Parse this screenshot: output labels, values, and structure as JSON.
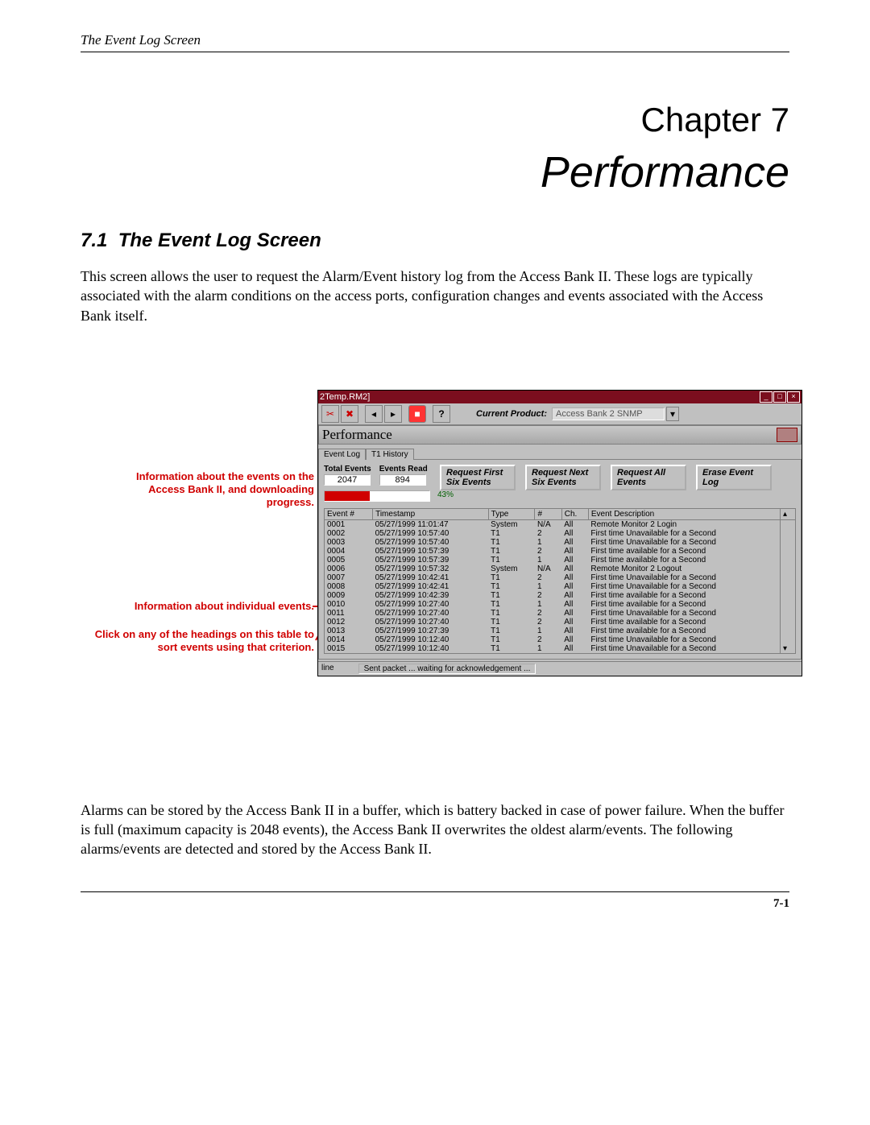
{
  "running_head": "The Event Log Screen",
  "chapter_label": "Chapter 7",
  "chapter_title": "Performance",
  "section_number": "7.1",
  "section_title": "The Event Log Screen",
  "paragraph1": "This screen allows the user to request the Alarm/Event history log from the Access Bank II. These logs are typically associated with the alarm conditions on the access ports, configuration changes and events associated with the Access Bank itself.",
  "paragraph2": "Alarms can be stored by the Access Bank II in a buffer, which is battery backed in case of power failure. When the buffer is full (maximum capacity is 2048 events), the Access Bank II overwrites the oldest alarm/events. The following alarms/events are detected and stored by the Access Bank II.",
  "callout1": "Information about the events on the Access Bank II, and downloading progress.",
  "callout2": "Information about individual events.",
  "callout3": "Click on any of the headings on this table to sort events using that criterion.",
  "window": {
    "title": "2Temp.RM2]",
    "current_product_label": "Current Product:",
    "current_product_value": "Access Bank 2 SNMP",
    "perf_header": "Performance",
    "tabs": {
      "event_log": "Event Log",
      "t1_history": "T1 History"
    },
    "stats": {
      "total_label": "Total Events",
      "total_value": "2047",
      "read_label": "Events Read",
      "read_value": "894",
      "progress_pct": "43%"
    },
    "buttons": {
      "req_first": "Request First Six Events",
      "req_next": "Request Next Six Events",
      "req_all": "Request All Events",
      "erase": "Erase Event Log"
    },
    "columns": [
      "Event #",
      "Timestamp",
      "Type",
      "#",
      "Ch.",
      "Event Description"
    ],
    "rows": [
      [
        "0001",
        "05/27/1999  11:01:47",
        "System",
        "N/A",
        "All",
        "Remote Monitor 2 Login"
      ],
      [
        "0002",
        "05/27/1999  10:57:40",
        "T1",
        "2",
        "All",
        "First time Unavailable for a Second"
      ],
      [
        "0003",
        "05/27/1999  10:57:40",
        "T1",
        "1",
        "All",
        "First time Unavailable for a Second"
      ],
      [
        "0004",
        "05/27/1999  10:57:39",
        "T1",
        "2",
        "All",
        "First time available for a Second"
      ],
      [
        "0005",
        "05/27/1999  10:57:39",
        "T1",
        "1",
        "All",
        "First time available for a Second"
      ],
      [
        "0006",
        "05/27/1999  10:57:32",
        "System",
        "N/A",
        "All",
        "Remote Monitor 2 Logout"
      ],
      [
        "0007",
        "05/27/1999  10:42:41",
        "T1",
        "2",
        "All",
        "First time Unavailable for a Second"
      ],
      [
        "0008",
        "05/27/1999  10:42:41",
        "T1",
        "1",
        "All",
        "First time Unavailable for a Second"
      ],
      [
        "0009",
        "05/27/1999  10:42:39",
        "T1",
        "2",
        "All",
        "First time available for a Second"
      ],
      [
        "0010",
        "05/27/1999  10:27:40",
        "T1",
        "1",
        "All",
        "First time available for a Second"
      ],
      [
        "0011",
        "05/27/1999  10:27:40",
        "T1",
        "2",
        "All",
        "First time Unavailable for a Second"
      ],
      [
        "0012",
        "05/27/1999  10:27:40",
        "T1",
        "2",
        "All",
        "First time available for a Second"
      ],
      [
        "0013",
        "05/27/1999  10:27:39",
        "T1",
        "1",
        "All",
        "First time available for a Second"
      ],
      [
        "0014",
        "05/27/1999  10:12:40",
        "T1",
        "2",
        "All",
        "First time Unavailable for a Second"
      ],
      [
        "0015",
        "05/27/1999  10:12:40",
        "T1",
        "1",
        "All",
        "First time Unavailable for a Second"
      ]
    ],
    "status_left": "line",
    "status_right": "Sent packet ... waiting for acknowledgement ..."
  },
  "page_number": "7-1"
}
